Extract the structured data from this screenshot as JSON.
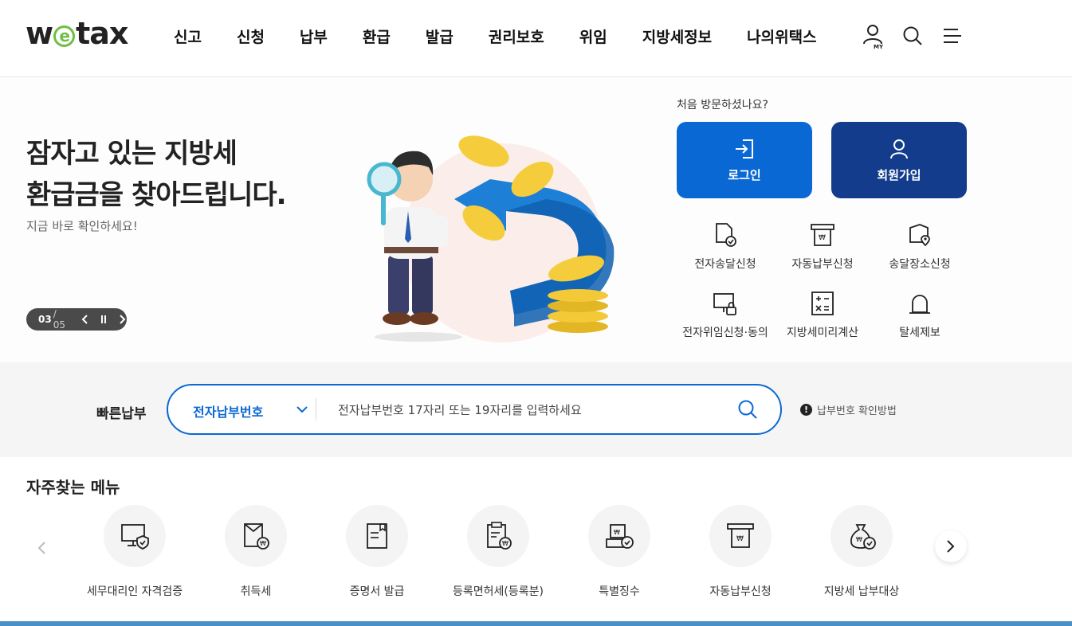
{
  "header": {
    "logo": {
      "prefix": "w",
      "e": "e",
      "suffix": "tax"
    },
    "nav": [
      "신고",
      "신청",
      "납부",
      "환급",
      "발급",
      "권리보호",
      "위임",
      "지방세정보",
      "나의위택스"
    ],
    "icons": [
      "my-user-icon",
      "search-icon",
      "menu-icon"
    ]
  },
  "hero": {
    "title_line1": "잠자고 있는 지방세",
    "title_line2": "환급금을 찾아드립니다.",
    "subtitle": "지금 바로 확인하세요!",
    "pager": {
      "current": "03",
      "total": "/ 05"
    },
    "first_visit": "처음 방문하셨나요?",
    "login_label": "로그인",
    "join_label": "회원가입",
    "quick": [
      {
        "label": "전자송달신청",
        "icon": "document-check-icon"
      },
      {
        "label": "자동납부신청",
        "icon": "auto-pay-icon"
      },
      {
        "label": "송달장소신청",
        "icon": "location-doc-icon"
      },
      {
        "label": "전자위임신청·동의",
        "icon": "monitor-lock-icon"
      },
      {
        "label": "지방세미리계산",
        "icon": "calculator-icon"
      },
      {
        "label": "탈세제보",
        "icon": "siren-icon"
      }
    ]
  },
  "fastpay": {
    "label": "빠른납부",
    "select_value": "전자납부번호",
    "placeholder": "전자납부번호 17자리 또는 19자리를 입력하세요",
    "help": "납부번호 확인방법",
    "help_mark": "!"
  },
  "favorites": {
    "title": "자주찾는 메뉴",
    "items": [
      {
        "label": "세무대리인 자격검증",
        "icon": "monitor-shield-icon"
      },
      {
        "label": "취득세",
        "icon": "acquisition-tax-icon"
      },
      {
        "label": "증명서 발급",
        "icon": "certificate-icon"
      },
      {
        "label": "등록면허세(등록분)",
        "icon": "registration-tax-icon"
      },
      {
        "label": "특별징수",
        "icon": "special-collection-icon"
      },
      {
        "label": "자동납부신청",
        "icon": "auto-pay-icon"
      },
      {
        "label": "지방세 납부대상",
        "icon": "money-bag-icon"
      }
    ]
  },
  "colors": {
    "primary_blue": "#0a68d4",
    "dark_blue": "#143c8c",
    "logo_green": "#6fbe44"
  }
}
